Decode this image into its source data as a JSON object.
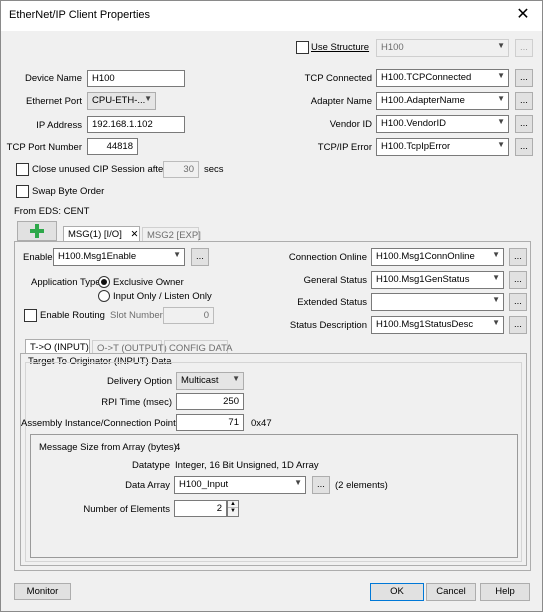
{
  "window": {
    "title": "EtherNet/IP Client Properties"
  },
  "top": {
    "use_structure_label": "Use Structure",
    "use_structure_value": "H100",
    "device_name_label": "Device Name",
    "device_name": "H100",
    "ethernet_port_label": "Ethernet Port",
    "ethernet_port": "CPU-ETH-...",
    "ip_label": "IP Address",
    "ip": "192.168.1.102",
    "tcp_port_label": "TCP Port Number",
    "tcp_port": "44818",
    "close_unused_label": "Close unused CIP Session after",
    "close_unused_value": "30",
    "secs": "secs",
    "swap_label": "Swap Byte Order",
    "from_eds": "From EDS: CENT",
    "tcp_connected_label": "TCP Connected",
    "tcp_connected": "H100.TCPConnected",
    "adapter_name_label": "Adapter Name",
    "adapter_name": "H100.AdapterName",
    "vendor_id_label": "Vendor ID",
    "vendor_id": "H100.VendorID",
    "tcpip_error_label": "TCP/IP Error",
    "tcpip_error": "H100.TcpIpError",
    "browse": "..."
  },
  "msg_tabs": {
    "tab1": "MSG(1) [I/O]",
    "tab2": "MSG2 [EXP]",
    "close": "✕"
  },
  "msg": {
    "enable_label": "Enable",
    "enable": "H100.Msg1Enable",
    "app_type_label": "Application Type",
    "exclusive": "Exclusive Owner",
    "input_only": "Input Only / Listen Only",
    "routing_label": "Enable Routing",
    "slot_label": "Slot Number",
    "slot": "0",
    "conn_online_label": "Connection Online",
    "conn_online": "H100.Msg1ConnOnline",
    "gen_status_label": "General Status",
    "gen_status": "H100.Msg1GenStatus",
    "ext_status_label": "Extended Status",
    "ext_status": "",
    "status_desc_label": "Status Description",
    "status_desc": "H100.Msg1StatusDesc"
  },
  "io_tabs": {
    "t_o": "T->O (INPUT)",
    "o_t": "O->T (OUTPUT)",
    "config": "CONFIG DATA"
  },
  "input": {
    "group_title": "Target To Originator (INPUT) Data",
    "delivery_label": "Delivery Option",
    "delivery": "Multicast",
    "rpi_label": "RPI Time (msec)",
    "rpi": "250",
    "assembly_label": "Assembly Instance/Connection Point",
    "assembly": "71",
    "assembly_hex": "0x47",
    "msgsize_label": "Message Size from Array (bytes)",
    "msgsize": "4",
    "datatype_label": "Datatype",
    "datatype": "Integer, 16 Bit Unsigned, 1D Array",
    "array_label": "Data Array",
    "array": "H100_Input",
    "elements_note": "(2 elements)",
    "num_elem_label": "Number of Elements",
    "num_elem": "2"
  },
  "footer": {
    "monitor": "Monitor",
    "ok": "OK",
    "cancel": "Cancel",
    "help": "Help"
  }
}
